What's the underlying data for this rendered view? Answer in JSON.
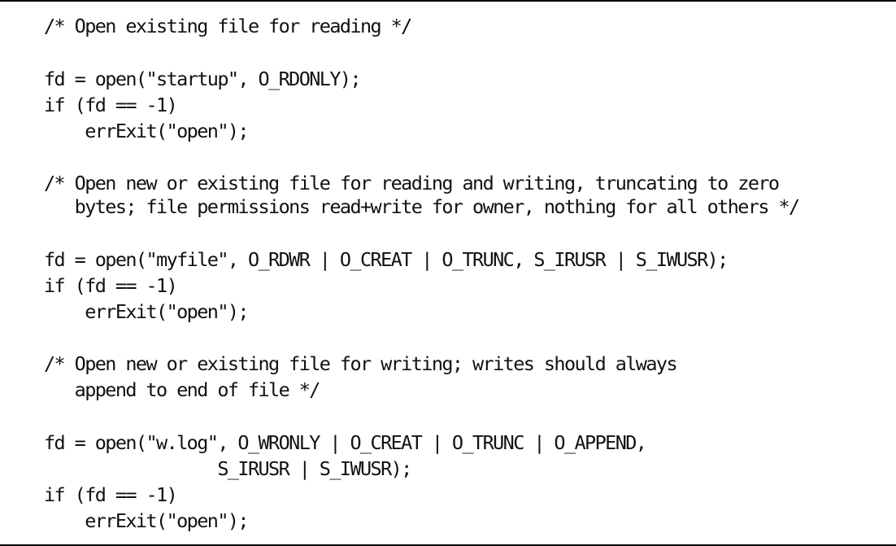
{
  "code": {
    "lines": [
      "/* Open existing file for reading */",
      "fd = open(\"startup\", O_RDONLY);",
      "if (fd == -1)",
      "    errExit(\"open\");",
      "/* Open new or existing file for reading and writing, truncating to zero",
      "   bytes; file permissions read+write for owner, nothing for all others */",
      "fd = open(\"myfile\", O_RDWR | O_CREAT | O_TRUNC, S_IRUSR | S_IWUSR);",
      "if (fd == -1)",
      "    errExit(\"open\");",
      "/* Open new or existing file for writing; writes should always",
      "   append to end of file */",
      "fd = open(\"w.log\", O_WRONLY | O_CREAT | O_TRUNC | O_APPEND,",
      "                 S_IRUSR | S_IWUSR);",
      "if (fd == -1)",
      "    errExit(\"open\");"
    ]
  }
}
